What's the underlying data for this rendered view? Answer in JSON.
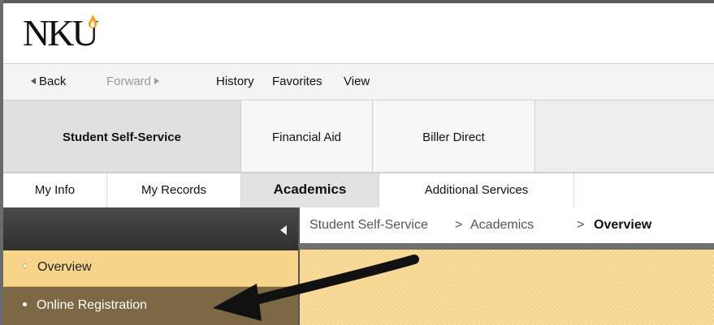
{
  "logo": {
    "text": "NKU",
    "accent_color": "#f2a71b"
  },
  "nav": {
    "back": "Back",
    "forward": "Forward",
    "history": "History",
    "favorites": "Favorites",
    "view": "View"
  },
  "tabs": [
    {
      "label": "Student Self-Service",
      "active": true
    },
    {
      "label": "Financial Aid",
      "active": false
    },
    {
      "label": "Biller Direct",
      "active": false
    }
  ],
  "subtabs": [
    {
      "label": "My Info",
      "active": false
    },
    {
      "label": "My Records",
      "active": false
    },
    {
      "label": "Academics",
      "active": true
    },
    {
      "label": "Additional Services",
      "active": false
    }
  ],
  "sidebar": {
    "items": [
      {
        "label": "Overview",
        "selected": false
      },
      {
        "label": "Online Registration",
        "selected": true
      }
    ]
  },
  "breadcrumb": {
    "items": [
      "Student Self-Service",
      "Academics",
      "Overview"
    ],
    "separator": ">"
  },
  "colors": {
    "sidebar_selected": "#7d6845",
    "sidebar_item": "#f6d48a",
    "content_bg": "#f7d58c"
  }
}
